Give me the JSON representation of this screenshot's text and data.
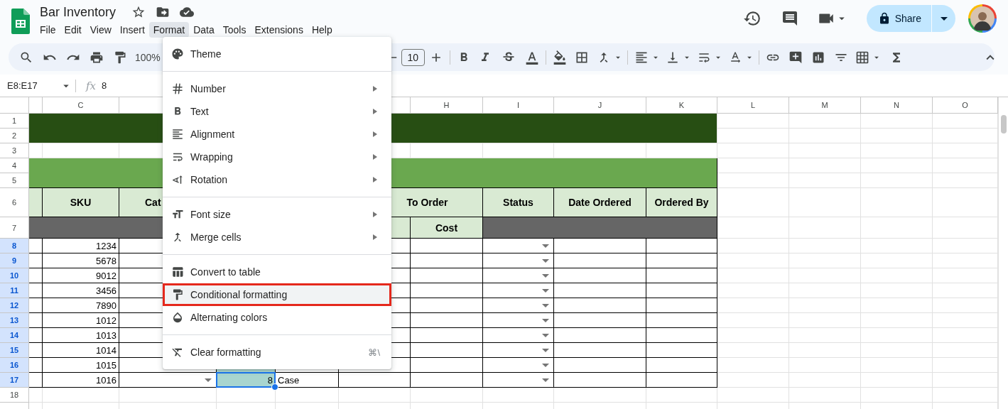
{
  "app": {
    "title": "Bar Inventory",
    "menus": [
      {
        "label": "File",
        "selected": false
      },
      {
        "label": "Edit",
        "selected": false
      },
      {
        "label": "View",
        "selected": false
      },
      {
        "label": "Insert",
        "selected": false
      },
      {
        "label": "Format",
        "selected": true
      },
      {
        "label": "Data",
        "selected": false
      },
      {
        "label": "Tools",
        "selected": false
      },
      {
        "label": "Extensions",
        "selected": false
      },
      {
        "label": "Help",
        "selected": false
      }
    ],
    "share": {
      "label": "Share"
    }
  },
  "toolbar": {
    "zoom": "100%",
    "font_size": "10"
  },
  "formula_bar": {
    "name_box": "E8:E17",
    "function_label": "fx",
    "value": "8"
  },
  "sheet": {
    "column_headers": [
      "C",
      "H",
      "I",
      "J",
      "K",
      "L",
      "M",
      "N",
      "O"
    ],
    "row_headers": [
      {
        "label": "1",
        "selected": false
      },
      {
        "label": "2",
        "selected": false
      },
      {
        "label": "3",
        "selected": false
      },
      {
        "label": "4",
        "selected": false
      },
      {
        "label": "5",
        "selected": false
      },
      {
        "label": "6",
        "selected": false
      },
      {
        "label": "7",
        "selected": false
      },
      {
        "label": "8",
        "selected": true
      },
      {
        "label": "9",
        "selected": true
      },
      {
        "label": "10",
        "selected": true
      },
      {
        "label": "11",
        "selected": true
      },
      {
        "label": "12",
        "selected": true
      },
      {
        "label": "13",
        "selected": true
      },
      {
        "label": "14",
        "selected": true
      },
      {
        "label": "15",
        "selected": true
      },
      {
        "label": "16",
        "selected": true
      },
      {
        "label": "17",
        "selected": true
      },
      {
        "label": "18",
        "selected": false
      }
    ],
    "header_row": [
      "SKU",
      "Cat",
      "To Order",
      "Status",
      "Date Ordered",
      "Ordered By"
    ],
    "subheader": "Cost",
    "rows": [
      {
        "sku": "1234",
        "status_dropdown": true
      },
      {
        "sku": "5678",
        "status_dropdown": true
      },
      {
        "sku": "9012",
        "status_dropdown": true
      },
      {
        "sku": "3456",
        "status_dropdown": true
      },
      {
        "sku": "7890",
        "status_dropdown": true
      },
      {
        "sku": "1012",
        "status_dropdown": true
      },
      {
        "sku": "1013",
        "status_dropdown": true
      },
      {
        "sku": "1014",
        "status_dropdown": true
      },
      {
        "sku": "1015",
        "in_selection": true,
        "active": false,
        "status_dropdown": true
      },
      {
        "sku": "1016",
        "in_selection": true,
        "active": true,
        "status_dropdown": true,
        "category_dropdown": true,
        "quantity": "8",
        "unit": "Case"
      }
    ]
  },
  "format_menu": {
    "items": [
      {
        "kind": "item",
        "label": "Theme",
        "has_submenu": false,
        "highlighted": false
      },
      {
        "kind": "divider"
      },
      {
        "kind": "item",
        "label": "Number",
        "has_submenu": true,
        "highlighted": false
      },
      {
        "kind": "item",
        "label": "Text",
        "has_submenu": true,
        "highlighted": false
      },
      {
        "kind": "item",
        "label": "Alignment",
        "has_submenu": true,
        "highlighted": false
      },
      {
        "kind": "item",
        "label": "Wrapping",
        "has_submenu": true,
        "highlighted": false
      },
      {
        "kind": "item",
        "label": "Rotation",
        "has_submenu": true,
        "highlighted": false
      },
      {
        "kind": "divider"
      },
      {
        "kind": "item",
        "label": "Font size",
        "has_submenu": true,
        "highlighted": false
      },
      {
        "kind": "item",
        "label": "Merge cells",
        "has_submenu": true,
        "highlighted": false
      },
      {
        "kind": "divider"
      },
      {
        "kind": "item",
        "label": "Convert to table",
        "has_submenu": false,
        "highlighted": false
      },
      {
        "kind": "item",
        "label": "Conditional formatting",
        "has_submenu": false,
        "highlighted": true
      },
      {
        "kind": "item",
        "label": "Alternating colors",
        "has_submenu": false,
        "highlighted": false
      },
      {
        "kind": "divider"
      },
      {
        "kind": "item",
        "label": "Clear formatting",
        "has_submenu": false,
        "highlighted": false,
        "shortcut": "⌘\\"
      }
    ]
  }
}
